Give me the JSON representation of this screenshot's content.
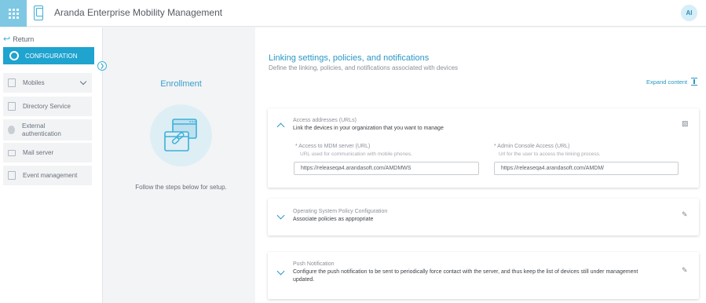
{
  "header": {
    "app_title": "Aranda Enterprise Mobility Management",
    "avatar_initials": "AI"
  },
  "sidebar": {
    "return_label": "Return",
    "active_item": "CONFIGURATION",
    "items": [
      {
        "label": "Mobiles",
        "icon": "mobile-grid-icon"
      },
      {
        "label": "Directory Service",
        "icon": "directory-icon"
      },
      {
        "label": "External authentication",
        "icon": "fingerprint-icon"
      },
      {
        "label": "Mail server",
        "icon": "mail-icon"
      },
      {
        "label": "Event management",
        "icon": "calendar-icon"
      }
    ]
  },
  "enrollment": {
    "title": "Enrollment",
    "caption": "Follow the steps below for setup."
  },
  "main": {
    "title": "Linking settings, policies, and notifications",
    "subtitle": "Define the linking, policies, and notifications associated with devices",
    "expand_label": "Expand content"
  },
  "cards": {
    "access": {
      "title": "Access addresses (URLs)",
      "description": "Link the devices in your organization that you want to manage",
      "mdm_label": "* Access to MDM server (URL)",
      "mdm_help": "URL used for communication with mobile phones.",
      "mdm_value": "https://releaseqa4.arandasoft.com/AMDMWS",
      "admin_label": "* Admin Console Access (URL)",
      "admin_help": "Url for the user to access the linking process.",
      "admin_value": "https://releaseqa4.arandasoft.com/AMDM/"
    },
    "policy": {
      "title": "Operating System Policy Configuration",
      "description": "Associate policies as appropriate"
    },
    "push": {
      "title": "Push Notification",
      "description": "Configure the push notification to be sent to periodically force contact with the server, and thus keep the list of devices still under management updated."
    }
  },
  "colors": {
    "accent": "#1fa3cf",
    "apps_button": "#7ec8e3",
    "link": "#2a97c4"
  }
}
